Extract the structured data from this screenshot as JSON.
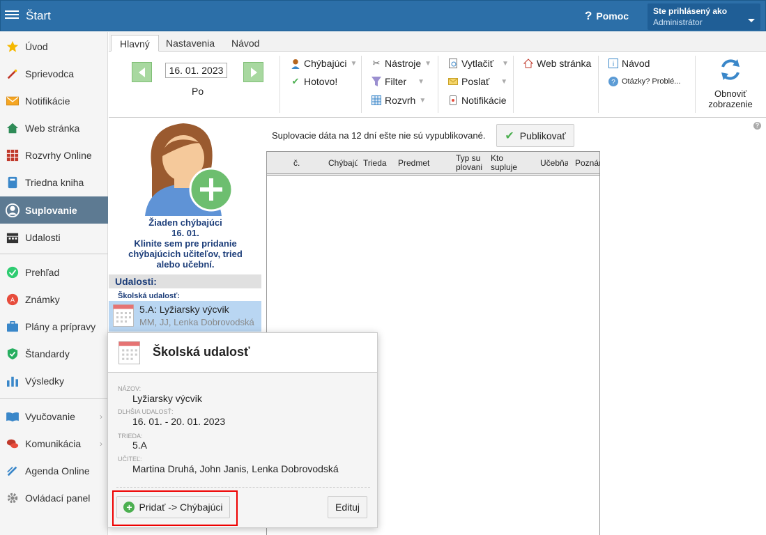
{
  "header": {
    "app_title": "Štart",
    "help_label": "Pomoc",
    "user_label": "Ste prihlásený ako",
    "user_name": "Administrátor"
  },
  "sidebar": {
    "items": [
      {
        "label": "Úvod",
        "icon": "star-icon"
      },
      {
        "label": "Sprievodca",
        "icon": "wand-icon"
      },
      {
        "label": "Notifikácie",
        "icon": "envelope-icon"
      },
      {
        "label": "Web stránka",
        "icon": "house-icon"
      },
      {
        "label": "Rozvrhy Online",
        "icon": "timetable-icon"
      },
      {
        "label": "Triedna kniha",
        "icon": "book-icon"
      },
      {
        "label": "Suplovanie",
        "icon": "person-icon",
        "active": true
      },
      {
        "label": "Udalosti",
        "icon": "calendar-icon"
      },
      {
        "label": "Prehľad",
        "icon": "check-circle-icon"
      },
      {
        "label": "Známky",
        "icon": "grades-icon"
      },
      {
        "label": "Plány a prípravy",
        "icon": "briefcase-icon"
      },
      {
        "label": "Štandardy",
        "icon": "shield-icon"
      },
      {
        "label": "Výsledky",
        "icon": "bar-chart-icon"
      },
      {
        "label": "Vyučovanie",
        "icon": "open-book-icon"
      },
      {
        "label": "Komunikácia",
        "icon": "chat-icon"
      },
      {
        "label": "Agenda Online",
        "icon": "pen-icon"
      },
      {
        "label": "Ovládací panel",
        "icon": "gear-icon"
      }
    ]
  },
  "tabs": [
    "Hlavný",
    "Nastavenia",
    "Návod"
  ],
  "ribbon": {
    "date": "16. 01. 2023",
    "day": "Po",
    "absent": "Chýbajúci",
    "done": "Hotovo!",
    "tools": "Nástroje",
    "filter": "Filter",
    "schedule": "Rozvrh",
    "print": "Vytlačiť",
    "send": "Poslať",
    "notifications": "Notifikácie",
    "web": "Web stránka",
    "guide": "Návod",
    "questions": "Otázky? Problé...",
    "refresh_line1": "Obnoviť",
    "refresh_line2": "zobrazenie"
  },
  "absent_card": {
    "line1": "Žiaden chýbajúci",
    "line2": "16. 01.",
    "line3": "Klinite sem pre pridanie",
    "line4": "chýbajúcich učiteľov, tried",
    "line5": "alebo učební."
  },
  "events": {
    "heading": "Udalosti:",
    "subheading": "Školská udalosť:",
    "item_title": "5.A: Lyžiarsky výcvik",
    "item_people": "MM, JJ, Lenka Dobrovodská"
  },
  "main": {
    "notice": "Suplovacie dáta na 12 dní ešte nie sú vypublikované.",
    "publish": "Publikovať",
    "columns": [
      "č.",
      "Chýbajúci",
      "Trieda",
      "Predmet",
      "Typ suplovania",
      "Kto supluje",
      "Učebňa",
      "Poznámka"
    ]
  },
  "popup": {
    "title": "Školská udalosť",
    "name_label": "NÁZOV:",
    "name_value": "Lyžiarsky výcvik",
    "longer_label": "DLHŠIA UDALOSŤ:",
    "longer_value": "16. 01. - 20. 01. 2023",
    "class_label": "TRIEDA:",
    "class_value": "5.A",
    "teacher_label": "UČITEĽ:",
    "teacher_value": "Martina Druhá, John Janis, Lenka Dobrovodská",
    "add_button": "Pridať -> Chýbajúci",
    "edit_button": "Edituj"
  }
}
